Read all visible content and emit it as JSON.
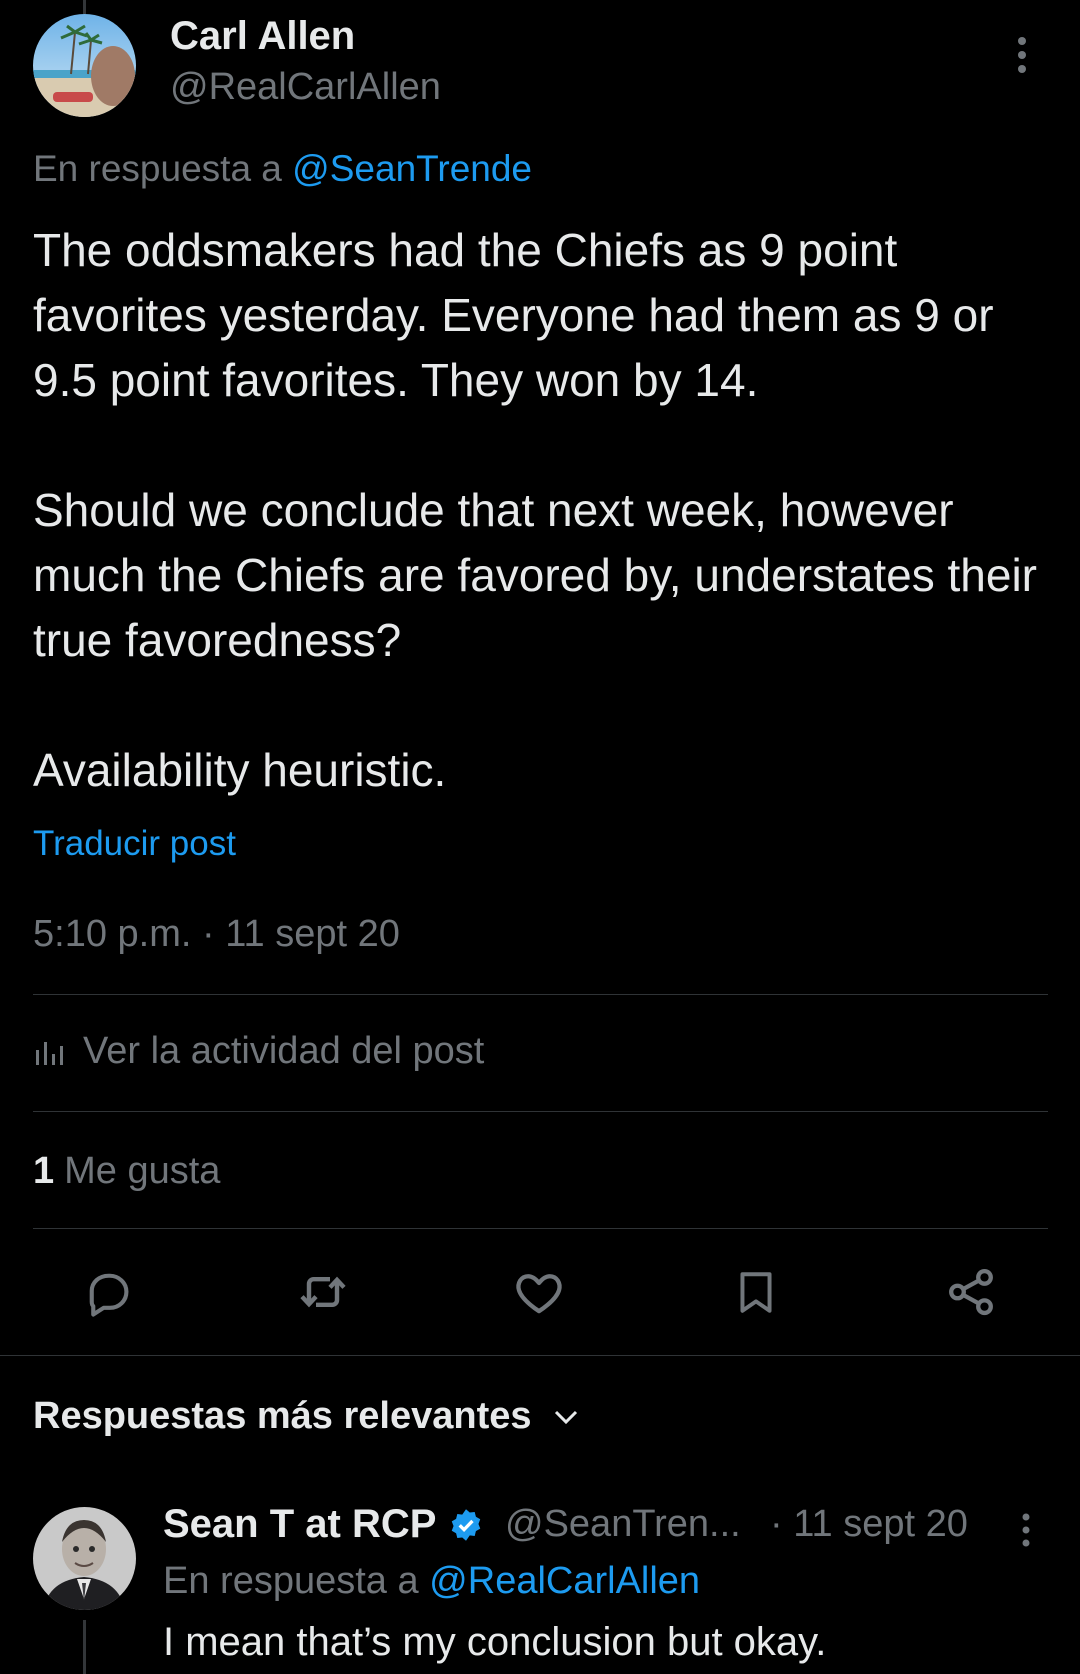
{
  "post": {
    "author_name": "Carl Allen",
    "author_handle": "@RealCarlAllen",
    "reply_prefix": "En respuesta a",
    "reply_to": "@SeanTrende",
    "paragraphs": [
      "The oddsmakers had the Chiefs as 9 point favorites yesterday. Everyone had them as 9 or 9.5 point favorites. They won by 14.",
      "Should we conclude that next week, however much the Chiefs are favored by, understates their true favoredness?",
      "Availability heuristic."
    ],
    "translate_label": "Traducir post",
    "timestamp": "5:10 p.m. · 11 sept 20",
    "activity_label": "Ver la actividad del post",
    "likes_count": "1",
    "likes_label": "Me gusta"
  },
  "actions": [
    "reply-icon",
    "repost-icon",
    "like-icon",
    "bookmark-icon",
    "share-icon"
  ],
  "replies_section": {
    "sort_label": "Respuestas más relevantes"
  },
  "reply": {
    "author_name": "Sean T at RCP",
    "verified": true,
    "author_handle": "@SeanTren...",
    "date": "· 11 sept 20",
    "reply_prefix": "En respuesta a",
    "reply_to": "@RealCarlAllen",
    "text": "I mean that’s my conclusion but okay."
  },
  "colors": {
    "background": "#000000",
    "text": "#e7e9ea",
    "muted": "#71767b",
    "accent": "#1d9bf0",
    "divider": "#2f3336"
  }
}
